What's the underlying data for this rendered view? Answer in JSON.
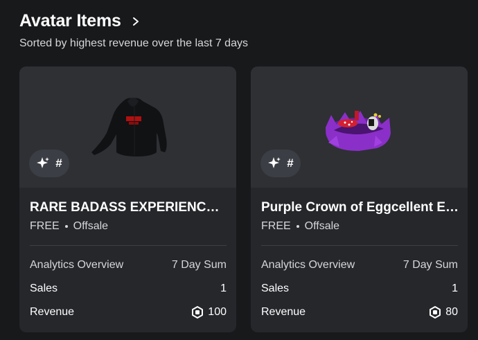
{
  "header": {
    "title": "Avatar Items",
    "subtitle": "Sorted by highest revenue over the last 7 days"
  },
  "icons": {
    "header_arrow": "chevron-right-icon",
    "badge": "sparkle-icon",
    "currency": "robux-icon"
  },
  "colors": {
    "background": "#18191b",
    "card": "#25272b",
    "thumbnail": "#2e3034",
    "badge": "#3b3e44"
  },
  "items": [
    {
      "badge_text": "#",
      "name": "RARE BADASS EXPERIENCES CONTROLLER HOODIE",
      "price": "FREE",
      "status": "Offsale",
      "overview_label": "Analytics Overview",
      "overview_value": "7 Day Sum",
      "sales_label": "Sales",
      "sales_value": "1",
      "revenue_label": "Revenue",
      "revenue_value": "100"
    },
    {
      "badge_text": "#",
      "name": "Purple Crown of Eggcellent Explorers",
      "price": "FREE",
      "status": "Offsale",
      "overview_label": "Analytics Overview",
      "overview_value": "7 Day Sum",
      "sales_label": "Sales",
      "sales_value": "1",
      "revenue_label": "Revenue",
      "revenue_value": "80"
    }
  ]
}
